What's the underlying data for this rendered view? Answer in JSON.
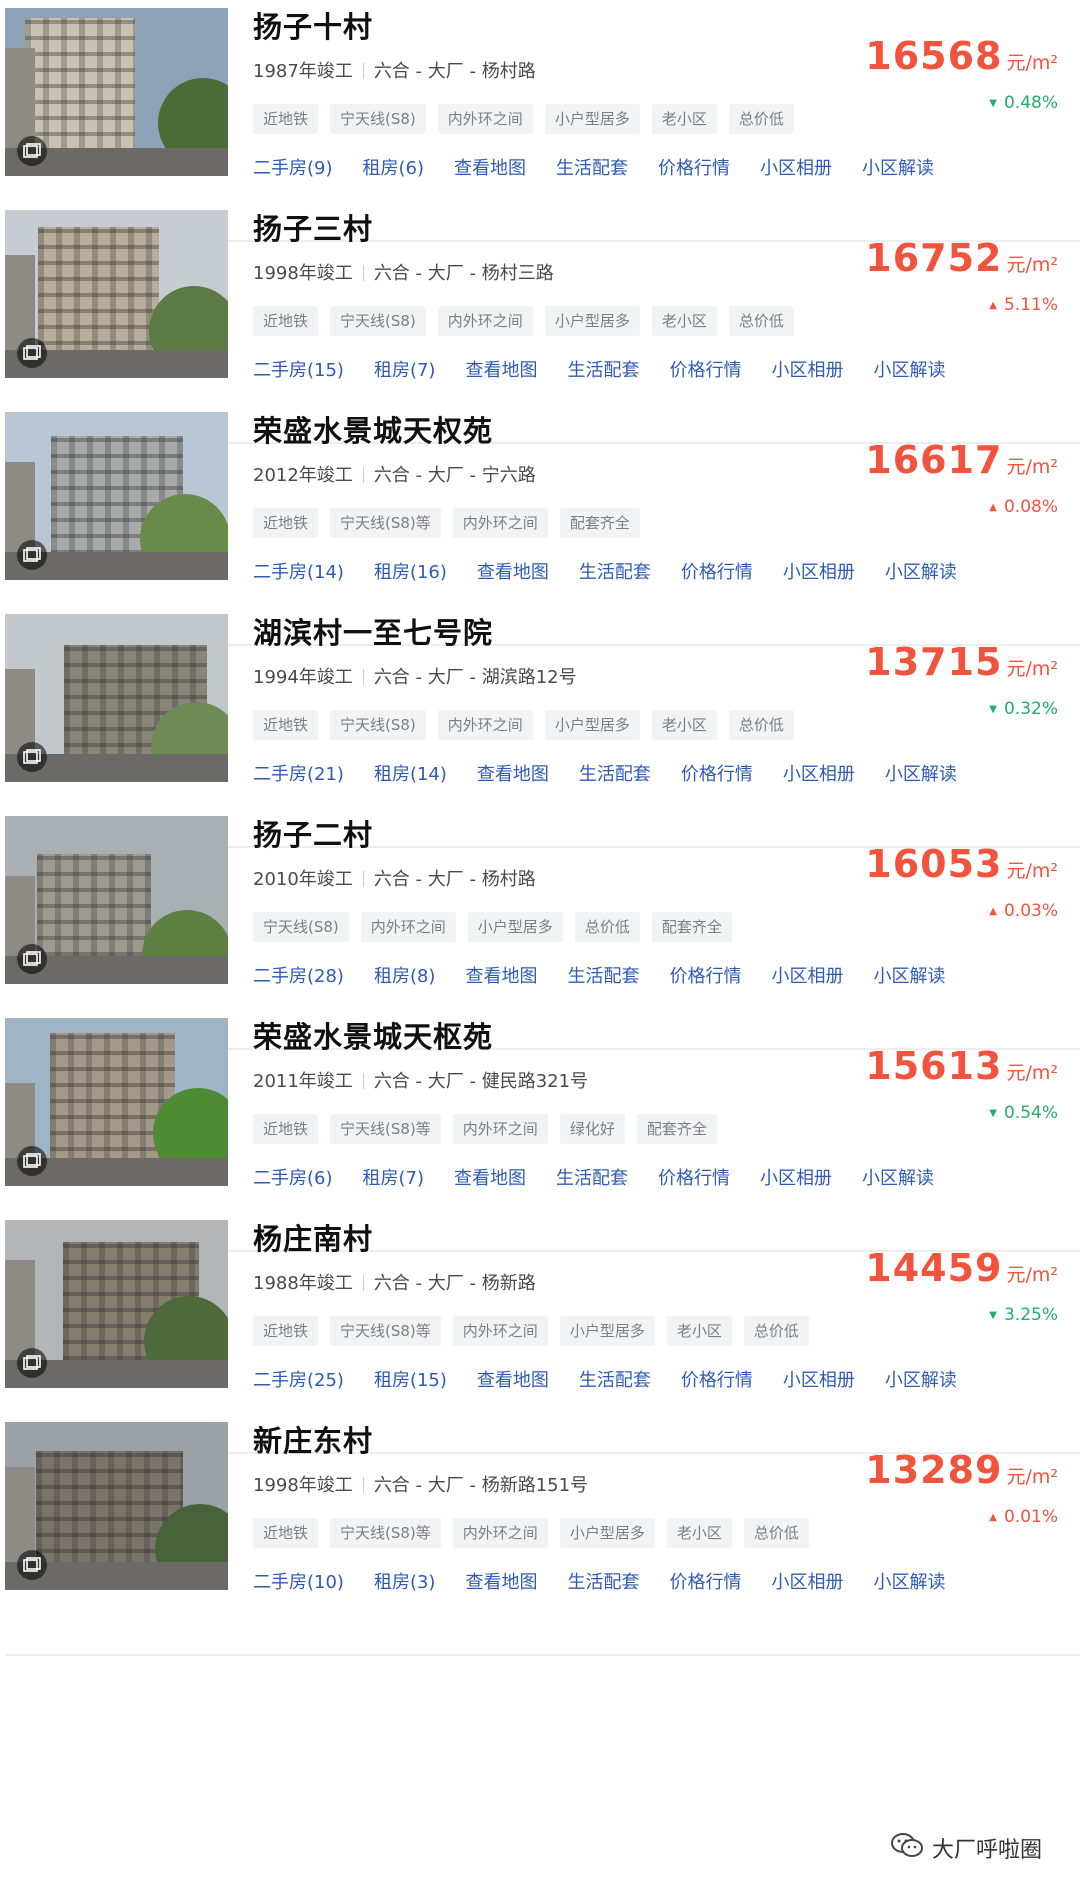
{
  "labels": {
    "unit": "元/m²"
  },
  "colors": {
    "price": "#f1533d",
    "up": "#f1533d",
    "down": "#1fae6a",
    "link": "#2f5bb7",
    "tag_bg": "#f2f3f5"
  },
  "listings": [
    {
      "name": "扬子十村",
      "year": "1987年竣工",
      "location": "六合 - 大厂 - 杨村路",
      "tags": [
        "近地铁",
        "宁天线(S8)",
        "内外环之间",
        "小户型居多",
        "老小区",
        "总价低"
      ],
      "links": [
        "二手房(9)",
        "租房(6)",
        "查看地图",
        "生活配套",
        "价格行情",
        "小区相册",
        "小区解读"
      ],
      "price": "16568",
      "change": "0.48%",
      "trend": "down"
    },
    {
      "name": "扬子三村",
      "year": "1998年竣工",
      "location": "六合 - 大厂 - 杨村三路",
      "tags": [
        "近地铁",
        "宁天线(S8)",
        "内外环之间",
        "小户型居多",
        "老小区",
        "总价低"
      ],
      "links": [
        "二手房(15)",
        "租房(7)",
        "查看地图",
        "生活配套",
        "价格行情",
        "小区相册",
        "小区解读"
      ],
      "price": "16752",
      "change": "5.11%",
      "trend": "up"
    },
    {
      "name": "荣盛水景城天权苑",
      "year": "2012年竣工",
      "location": "六合 - 大厂 - 宁六路",
      "tags": [
        "近地铁",
        "宁天线(S8)等",
        "内外环之间",
        "配套齐全"
      ],
      "links": [
        "二手房(14)",
        "租房(16)",
        "查看地图",
        "生活配套",
        "价格行情",
        "小区相册",
        "小区解读"
      ],
      "price": "16617",
      "change": "0.08%",
      "trend": "up"
    },
    {
      "name": "湖滨村一至七号院",
      "year": "1994年竣工",
      "location": "六合 - 大厂 - 湖滨路12号",
      "tags": [
        "近地铁",
        "宁天线(S8)",
        "内外环之间",
        "小户型居多",
        "老小区",
        "总价低"
      ],
      "links": [
        "二手房(21)",
        "租房(14)",
        "查看地图",
        "生活配套",
        "价格行情",
        "小区相册",
        "小区解读"
      ],
      "price": "13715",
      "change": "0.32%",
      "trend": "down"
    },
    {
      "name": "扬子二村",
      "year": "2010年竣工",
      "location": "六合 - 大厂 - 杨村路",
      "tags": [
        "宁天线(S8)",
        "内外环之间",
        "小户型居多",
        "总价低",
        "配套齐全"
      ],
      "links": [
        "二手房(28)",
        "租房(8)",
        "查看地图",
        "生活配套",
        "价格行情",
        "小区相册",
        "小区解读"
      ],
      "price": "16053",
      "change": "0.03%",
      "trend": "up"
    },
    {
      "name": "荣盛水景城天枢苑",
      "year": "2011年竣工",
      "location": "六合 - 大厂 - 健民路321号",
      "tags": [
        "近地铁",
        "宁天线(S8)等",
        "内外环之间",
        "绿化好",
        "配套齐全"
      ],
      "links": [
        "二手房(6)",
        "租房(7)",
        "查看地图",
        "生活配套",
        "价格行情",
        "小区相册",
        "小区解读"
      ],
      "price": "15613",
      "change": "0.54%",
      "trend": "down"
    },
    {
      "name": "杨庄南村",
      "year": "1988年竣工",
      "location": "六合 - 大厂 - 杨新路",
      "tags": [
        "近地铁",
        "宁天线(S8)等",
        "内外环之间",
        "小户型居多",
        "老小区",
        "总价低"
      ],
      "links": [
        "二手房(25)",
        "租房(15)",
        "查看地图",
        "生活配套",
        "价格行情",
        "小区相册",
        "小区解读"
      ],
      "price": "14459",
      "change": "3.25%",
      "trend": "down"
    },
    {
      "name": "新庄东村",
      "year": "1998年竣工",
      "location": "六合 - 大厂 - 杨新路151号",
      "tags": [
        "近地铁",
        "宁天线(S8)等",
        "内外环之间",
        "小户型居多",
        "老小区",
        "总价低"
      ],
      "links": [
        "二手房(10)",
        "租房(3)",
        "查看地图",
        "生活配套",
        "价格行情",
        "小区相册",
        "小区解读"
      ],
      "price": "13289",
      "change": "0.01%",
      "trend": "up"
    }
  ],
  "watermark": {
    "text": "大厂呼啦圈",
    "icon": "wechat-icon"
  }
}
